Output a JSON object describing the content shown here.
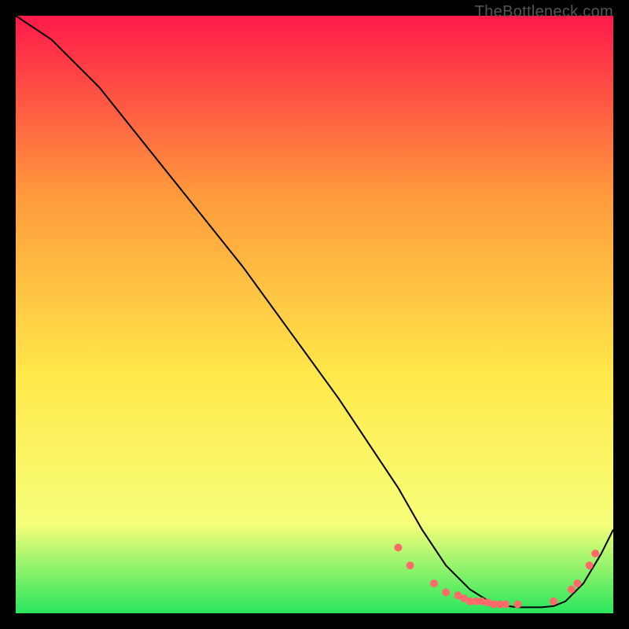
{
  "watermark": "TheBottleneck.com",
  "chart_data": {
    "type": "line",
    "title": "",
    "xlabel": "",
    "ylabel": "",
    "xlim": [
      0,
      100
    ],
    "ylim": [
      0,
      100
    ],
    "gradient_top": "#ff1a4a",
    "gradient_mid1": "#ff9a3c",
    "gradient_mid2": "#ffe84a",
    "gradient_mid3": "#f7ff7a",
    "gradient_bottom": "#28e65c",
    "curve": {
      "color": "#000000",
      "width": 2,
      "x": [
        0,
        6,
        14,
        22,
        30,
        38,
        46,
        54,
        60,
        64,
        68,
        72,
        76,
        80,
        84,
        88,
        90,
        92,
        95,
        98,
        100
      ],
      "y": [
        100,
        96,
        88,
        78,
        68,
        58,
        47,
        36,
        27,
        21,
        14,
        8,
        4,
        1.5,
        1,
        1,
        1.2,
        2,
        5,
        10,
        14
      ]
    },
    "markers": {
      "color": "#ff6a6a",
      "radius": 5,
      "x": [
        64,
        66,
        70,
        72,
        74,
        75,
        76,
        77,
        78,
        79,
        80,
        81,
        82,
        84,
        90,
        93,
        94,
        96,
        97
      ],
      "y": [
        11,
        8,
        5,
        3.5,
        3,
        2.5,
        2,
        2,
        2,
        1.8,
        1.5,
        1.5,
        1.5,
        1.5,
        2,
        4,
        5,
        8,
        10
      ]
    }
  }
}
